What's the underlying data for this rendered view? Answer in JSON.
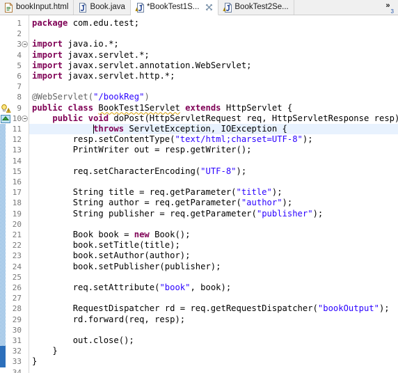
{
  "window": {
    "app": "Eclipse IDE Java Editor",
    "active_file": "*BookTest1S..."
  },
  "tabs": [
    {
      "label": "bookInput.html",
      "icon": "html-file-icon",
      "active": false,
      "dirty": false,
      "warning": false,
      "closable": false
    },
    {
      "label": "Book.java",
      "icon": "java-file-icon",
      "active": false,
      "dirty": false,
      "warning": false,
      "closable": false
    },
    {
      "label": "*BookTest1S...",
      "icon": "java-file-warning-icon",
      "active": true,
      "dirty": true,
      "warning": true,
      "closable": true
    },
    {
      "label": "BookTest2Se...",
      "icon": "java-file-warning-icon",
      "active": false,
      "dirty": false,
      "warning": true,
      "closable": false
    }
  ],
  "tab_overflow": {
    "chevron": "»",
    "count": "3"
  },
  "editor": {
    "first_line": 1,
    "last_line": 34,
    "cursor_line": 11,
    "cursor_column": 13,
    "highlighted_line": 11,
    "fold_lines": [
      3,
      10
    ],
    "markers": [
      {
        "line": 9,
        "type": "quickfix-warning-icon",
        "tooltip": "warning"
      },
      {
        "line": 10,
        "type": "override-method-icon",
        "tooltip": "implements method"
      }
    ],
    "lines": [
      {
        "n": 1,
        "tokens": [
          {
            "t": "kw",
            "v": "package"
          },
          {
            "t": "plain",
            "v": " com.edu.test;"
          }
        ]
      },
      {
        "n": 2,
        "tokens": []
      },
      {
        "n": 3,
        "tokens": [
          {
            "t": "kw",
            "v": "import"
          },
          {
            "t": "plain",
            "v": " java.io.*;"
          }
        ]
      },
      {
        "n": 4,
        "tokens": [
          {
            "t": "kw",
            "v": "import"
          },
          {
            "t": "plain",
            "v": " javax.servlet.*;"
          }
        ]
      },
      {
        "n": 5,
        "tokens": [
          {
            "t": "kw",
            "v": "import"
          },
          {
            "t": "plain",
            "v": " javax.servlet.annotation.WebServlet;"
          }
        ]
      },
      {
        "n": 6,
        "tokens": [
          {
            "t": "kw",
            "v": "import"
          },
          {
            "t": "plain",
            "v": " javax.servlet.http.*;"
          }
        ]
      },
      {
        "n": 7,
        "tokens": []
      },
      {
        "n": 8,
        "tokens": [
          {
            "t": "anno",
            "v": "@WebServlet("
          },
          {
            "t": "str",
            "v": "\"/bookReg\""
          },
          {
            "t": "anno",
            "v": ")"
          }
        ]
      },
      {
        "n": 9,
        "tokens": [
          {
            "t": "kw",
            "v": "public"
          },
          {
            "t": "plain",
            "v": " "
          },
          {
            "t": "kw",
            "v": "class"
          },
          {
            "t": "plain",
            "v": " "
          },
          {
            "t": "squiggle",
            "v": "BookTest1Servlet"
          },
          {
            "t": "plain",
            "v": " "
          },
          {
            "t": "kw",
            "v": "extends"
          },
          {
            "t": "plain",
            "v": " HttpServlet {"
          }
        ]
      },
      {
        "n": 10,
        "tokens": [
          {
            "t": "plain",
            "v": "    "
          },
          {
            "t": "kw",
            "v": "public"
          },
          {
            "t": "plain",
            "v": " "
          },
          {
            "t": "kw",
            "v": "void"
          },
          {
            "t": "plain",
            "v": " doPost(HttpServletRequest req, HttpServletResponse resp)"
          }
        ]
      },
      {
        "n": 11,
        "tokens": [
          {
            "t": "plain",
            "v": "            "
          },
          {
            "t": "kw",
            "v": "throws"
          },
          {
            "t": "plain",
            "v": " ServletException, IOException {"
          }
        ]
      },
      {
        "n": 12,
        "tokens": [
          {
            "t": "plain",
            "v": "        resp.setContentType("
          },
          {
            "t": "str",
            "v": "\"text/html;charset=UTF-8\""
          },
          {
            "t": "plain",
            "v": ");"
          }
        ]
      },
      {
        "n": 13,
        "tokens": [
          {
            "t": "plain",
            "v": "        PrintWriter out = resp.getWriter();"
          }
        ]
      },
      {
        "n": 14,
        "tokens": []
      },
      {
        "n": 15,
        "tokens": [
          {
            "t": "plain",
            "v": "        req.setCharacterEncoding("
          },
          {
            "t": "str",
            "v": "\"UTF-8\""
          },
          {
            "t": "plain",
            "v": ");"
          }
        ]
      },
      {
        "n": 16,
        "tokens": []
      },
      {
        "n": 17,
        "tokens": [
          {
            "t": "plain",
            "v": "        String title = req.getParameter("
          },
          {
            "t": "str",
            "v": "\"title\""
          },
          {
            "t": "plain",
            "v": ");"
          }
        ]
      },
      {
        "n": 18,
        "tokens": [
          {
            "t": "plain",
            "v": "        String author = req.getParameter("
          },
          {
            "t": "str",
            "v": "\"author\""
          },
          {
            "t": "plain",
            "v": ");"
          }
        ]
      },
      {
        "n": 19,
        "tokens": [
          {
            "t": "plain",
            "v": "        String publisher = req.getParameter("
          },
          {
            "t": "str",
            "v": "\"publisher\""
          },
          {
            "t": "plain",
            "v": ");"
          }
        ]
      },
      {
        "n": 20,
        "tokens": []
      },
      {
        "n": 21,
        "tokens": [
          {
            "t": "plain",
            "v": "        Book book = "
          },
          {
            "t": "kw",
            "v": "new"
          },
          {
            "t": "plain",
            "v": " Book();"
          }
        ]
      },
      {
        "n": 22,
        "tokens": [
          {
            "t": "plain",
            "v": "        book.setTitle(title);"
          }
        ]
      },
      {
        "n": 23,
        "tokens": [
          {
            "t": "plain",
            "v": "        book.setAuthor(author);"
          }
        ]
      },
      {
        "n": 24,
        "tokens": [
          {
            "t": "plain",
            "v": "        book.setPublisher(publisher);"
          }
        ]
      },
      {
        "n": 25,
        "tokens": []
      },
      {
        "n": 26,
        "tokens": [
          {
            "t": "plain",
            "v": "        req.setAttribute("
          },
          {
            "t": "str",
            "v": "\"book\""
          },
          {
            "t": "plain",
            "v": ", book);"
          }
        ]
      },
      {
        "n": 27,
        "tokens": []
      },
      {
        "n": 28,
        "tokens": [
          {
            "t": "plain",
            "v": "        RequestDispatcher rd = req.getRequestDispatcher("
          },
          {
            "t": "str",
            "v": "\"bookOutput\""
          },
          {
            "t": "plain",
            "v": ");"
          }
        ]
      },
      {
        "n": 29,
        "tokens": [
          {
            "t": "plain",
            "v": "        rd.forward(req, resp);"
          }
        ]
      },
      {
        "n": 30,
        "tokens": []
      },
      {
        "n": 31,
        "tokens": [
          {
            "t": "plain",
            "v": "        out.close();"
          }
        ]
      },
      {
        "n": 32,
        "tokens": [
          {
            "t": "plain",
            "v": "    }"
          }
        ]
      },
      {
        "n": 33,
        "tokens": [
          {
            "t": "plain",
            "v": "}"
          }
        ]
      },
      {
        "n": 34,
        "tokens": []
      }
    ],
    "change_bar_ranges": [
      {
        "from": 11,
        "to": 32,
        "style": "dotted"
      },
      {
        "from": 32,
        "to": 33,
        "style": "solid"
      }
    ]
  },
  "colors": {
    "keyword": "#7f0055",
    "string": "#2a00ff",
    "annotation": "#646464",
    "line_number": "#787878",
    "highlight_line_bg": "#e8f2fe",
    "warning_squiggle": "#d8a000",
    "tab_active_bg": "#ffffff",
    "tab_inactive_bg": "#f0f0f0",
    "editor_bg": "#ffffff"
  }
}
